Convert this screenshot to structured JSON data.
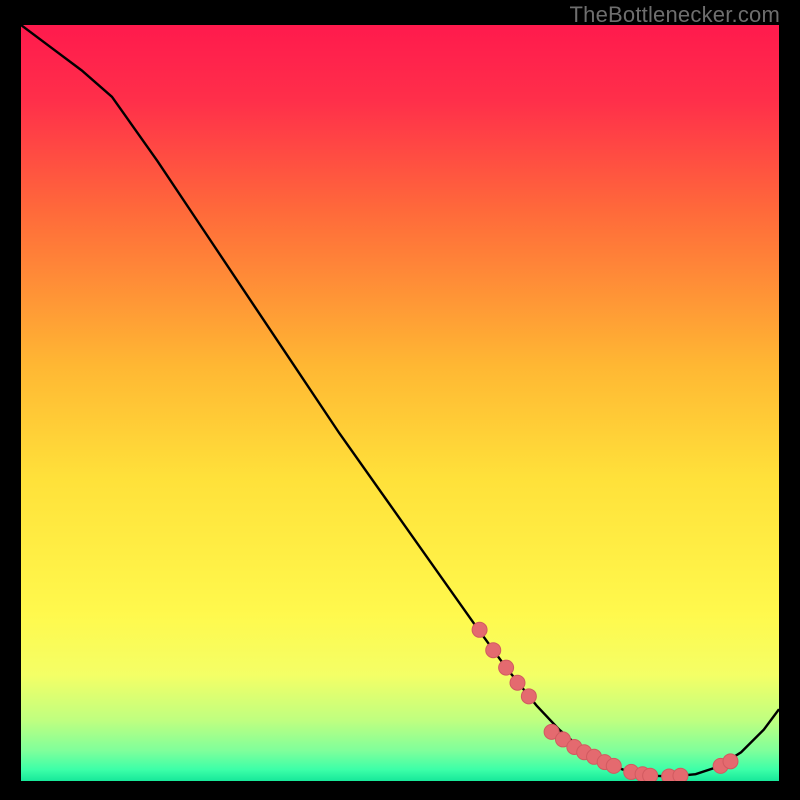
{
  "watermark": "TheBottlenecker.com",
  "colors": {
    "gradient_stops": [
      {
        "pos": 0.0,
        "color": "#ff1a4d"
      },
      {
        "pos": 0.1,
        "color": "#ff2f4a"
      },
      {
        "pos": 0.25,
        "color": "#ff6b3a"
      },
      {
        "pos": 0.45,
        "color": "#ffb733"
      },
      {
        "pos": 0.6,
        "color": "#ffe13a"
      },
      {
        "pos": 0.78,
        "color": "#fff94d"
      },
      {
        "pos": 0.86,
        "color": "#f4ff66"
      },
      {
        "pos": 0.92,
        "color": "#bfff80"
      },
      {
        "pos": 0.96,
        "color": "#7fff9b"
      },
      {
        "pos": 0.985,
        "color": "#3cffa8"
      },
      {
        "pos": 1.0,
        "color": "#17e89a"
      }
    ],
    "line": "#000000",
    "marker_fill": "#e46a6f",
    "marker_stroke": "#d15a60",
    "frame_bg": "#000000"
  },
  "chart_data": {
    "type": "line",
    "title": "",
    "xlabel": "",
    "ylabel": "",
    "xlim": [
      0,
      100
    ],
    "ylim": [
      0,
      100
    ],
    "series": [
      {
        "name": "bottleneck-curve",
        "x": [
          0,
          4,
          8,
          12,
          18,
          24,
          30,
          36,
          42,
          48,
          54,
          60,
          64,
          68,
          71,
          74,
          77,
          80,
          83,
          86,
          89,
          92,
          95,
          98,
          100
        ],
        "y": [
          100,
          97,
          94,
          90.5,
          82,
          73,
          64,
          55,
          46,
          37.5,
          29,
          20.5,
          15,
          10,
          6.8,
          4.2,
          2.4,
          1.3,
          0.7,
          0.6,
          0.9,
          1.9,
          3.8,
          6.8,
          9.5
        ]
      }
    ],
    "markers": {
      "name": "highlight-points",
      "x": [
        60.5,
        62.3,
        64.0,
        65.5,
        67.0,
        70.0,
        71.5,
        73.0,
        74.3,
        75.6,
        77.0,
        78.2,
        80.5,
        82.0,
        83.0,
        85.5,
        87.0,
        92.3,
        93.6
      ],
      "y": [
        20.0,
        17.3,
        15.0,
        13.0,
        11.2,
        6.5,
        5.5,
        4.5,
        3.8,
        3.2,
        2.5,
        2.0,
        1.2,
        0.9,
        0.7,
        0.6,
        0.7,
        2.0,
        2.6
      ]
    }
  }
}
